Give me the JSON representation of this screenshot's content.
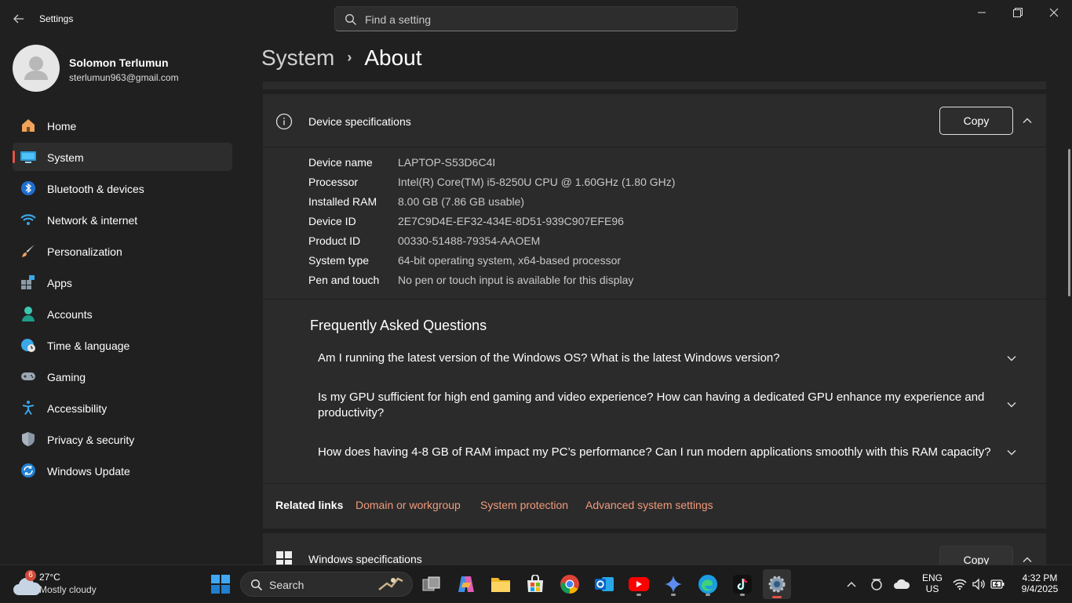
{
  "window": {
    "title": "Settings",
    "search_placeholder": "Find a setting"
  },
  "profile": {
    "name": "Solomon Terlumun",
    "email": "sterlumun963@gmail.com"
  },
  "nav": [
    {
      "label": "Home",
      "icon": "home-icon"
    },
    {
      "label": "System",
      "icon": "system-icon"
    },
    {
      "label": "Bluetooth & devices",
      "icon": "bluetooth-icon"
    },
    {
      "label": "Network & internet",
      "icon": "wifi-icon"
    },
    {
      "label": "Personalization",
      "icon": "paintbrush-icon"
    },
    {
      "label": "Apps",
      "icon": "apps-icon"
    },
    {
      "label": "Accounts",
      "icon": "person-icon"
    },
    {
      "label": "Time & language",
      "icon": "globe-clock-icon"
    },
    {
      "label": "Gaming",
      "icon": "gamepad-icon"
    },
    {
      "label": "Accessibility",
      "icon": "accessibility-icon"
    },
    {
      "label": "Privacy & security",
      "icon": "shield-icon"
    },
    {
      "label": "Windows Update",
      "icon": "update-icon"
    }
  ],
  "breadcrumb": {
    "parent": "System",
    "separator": "›",
    "current": "About"
  },
  "device_specs": {
    "title": "Device specifications",
    "copy_label": "Copy",
    "rows": [
      {
        "label": "Device name",
        "value": "LAPTOP-S53D6C4I"
      },
      {
        "label": "Processor",
        "value": "Intel(R) Core(TM) i5-8250U CPU @ 1.60GHz (1.80 GHz)"
      },
      {
        "label": "Installed RAM",
        "value": "8.00 GB (7.86 GB usable)"
      },
      {
        "label": "Device ID",
        "value": "2E7C9D4E-EF32-434E-8D51-939C907EFE96"
      },
      {
        "label": "Product ID",
        "value": "00330-51488-79354-AAOEM"
      },
      {
        "label": "System type",
        "value": "64-bit operating system, x64-based processor"
      },
      {
        "label": "Pen and touch",
        "value": "No pen or touch input is available for this display"
      }
    ]
  },
  "faq": {
    "title": "Frequently Asked Questions",
    "items": [
      "Am I running the latest version of the Windows OS? What is the latest Windows version?",
      "Is my GPU sufficient for high end gaming and video experience? How can having a dedicated GPU enhance my experience and productivity?",
      "How does having 4-8 GB of RAM impact my PC’s performance? Can I run modern applications smoothly with this RAM capacity?"
    ]
  },
  "related": {
    "label": "Related links",
    "links": [
      "Domain or workgroup",
      "System protection",
      "Advanced system settings"
    ]
  },
  "windows_specs": {
    "title": "Windows specifications",
    "copy_label": "Copy"
  },
  "taskbar": {
    "weather_badge": "6",
    "temperature": "27°C",
    "weather": "Mostly cloudy",
    "search_label": "Search",
    "lang_top": "ENG",
    "lang_bottom": "US",
    "time": "4:32 PM",
    "date": "9/4/2025"
  },
  "colors": {
    "accent": "#e2534a",
    "link": "#f29a7c",
    "background": "#202020",
    "card": "#2b2b2b"
  }
}
